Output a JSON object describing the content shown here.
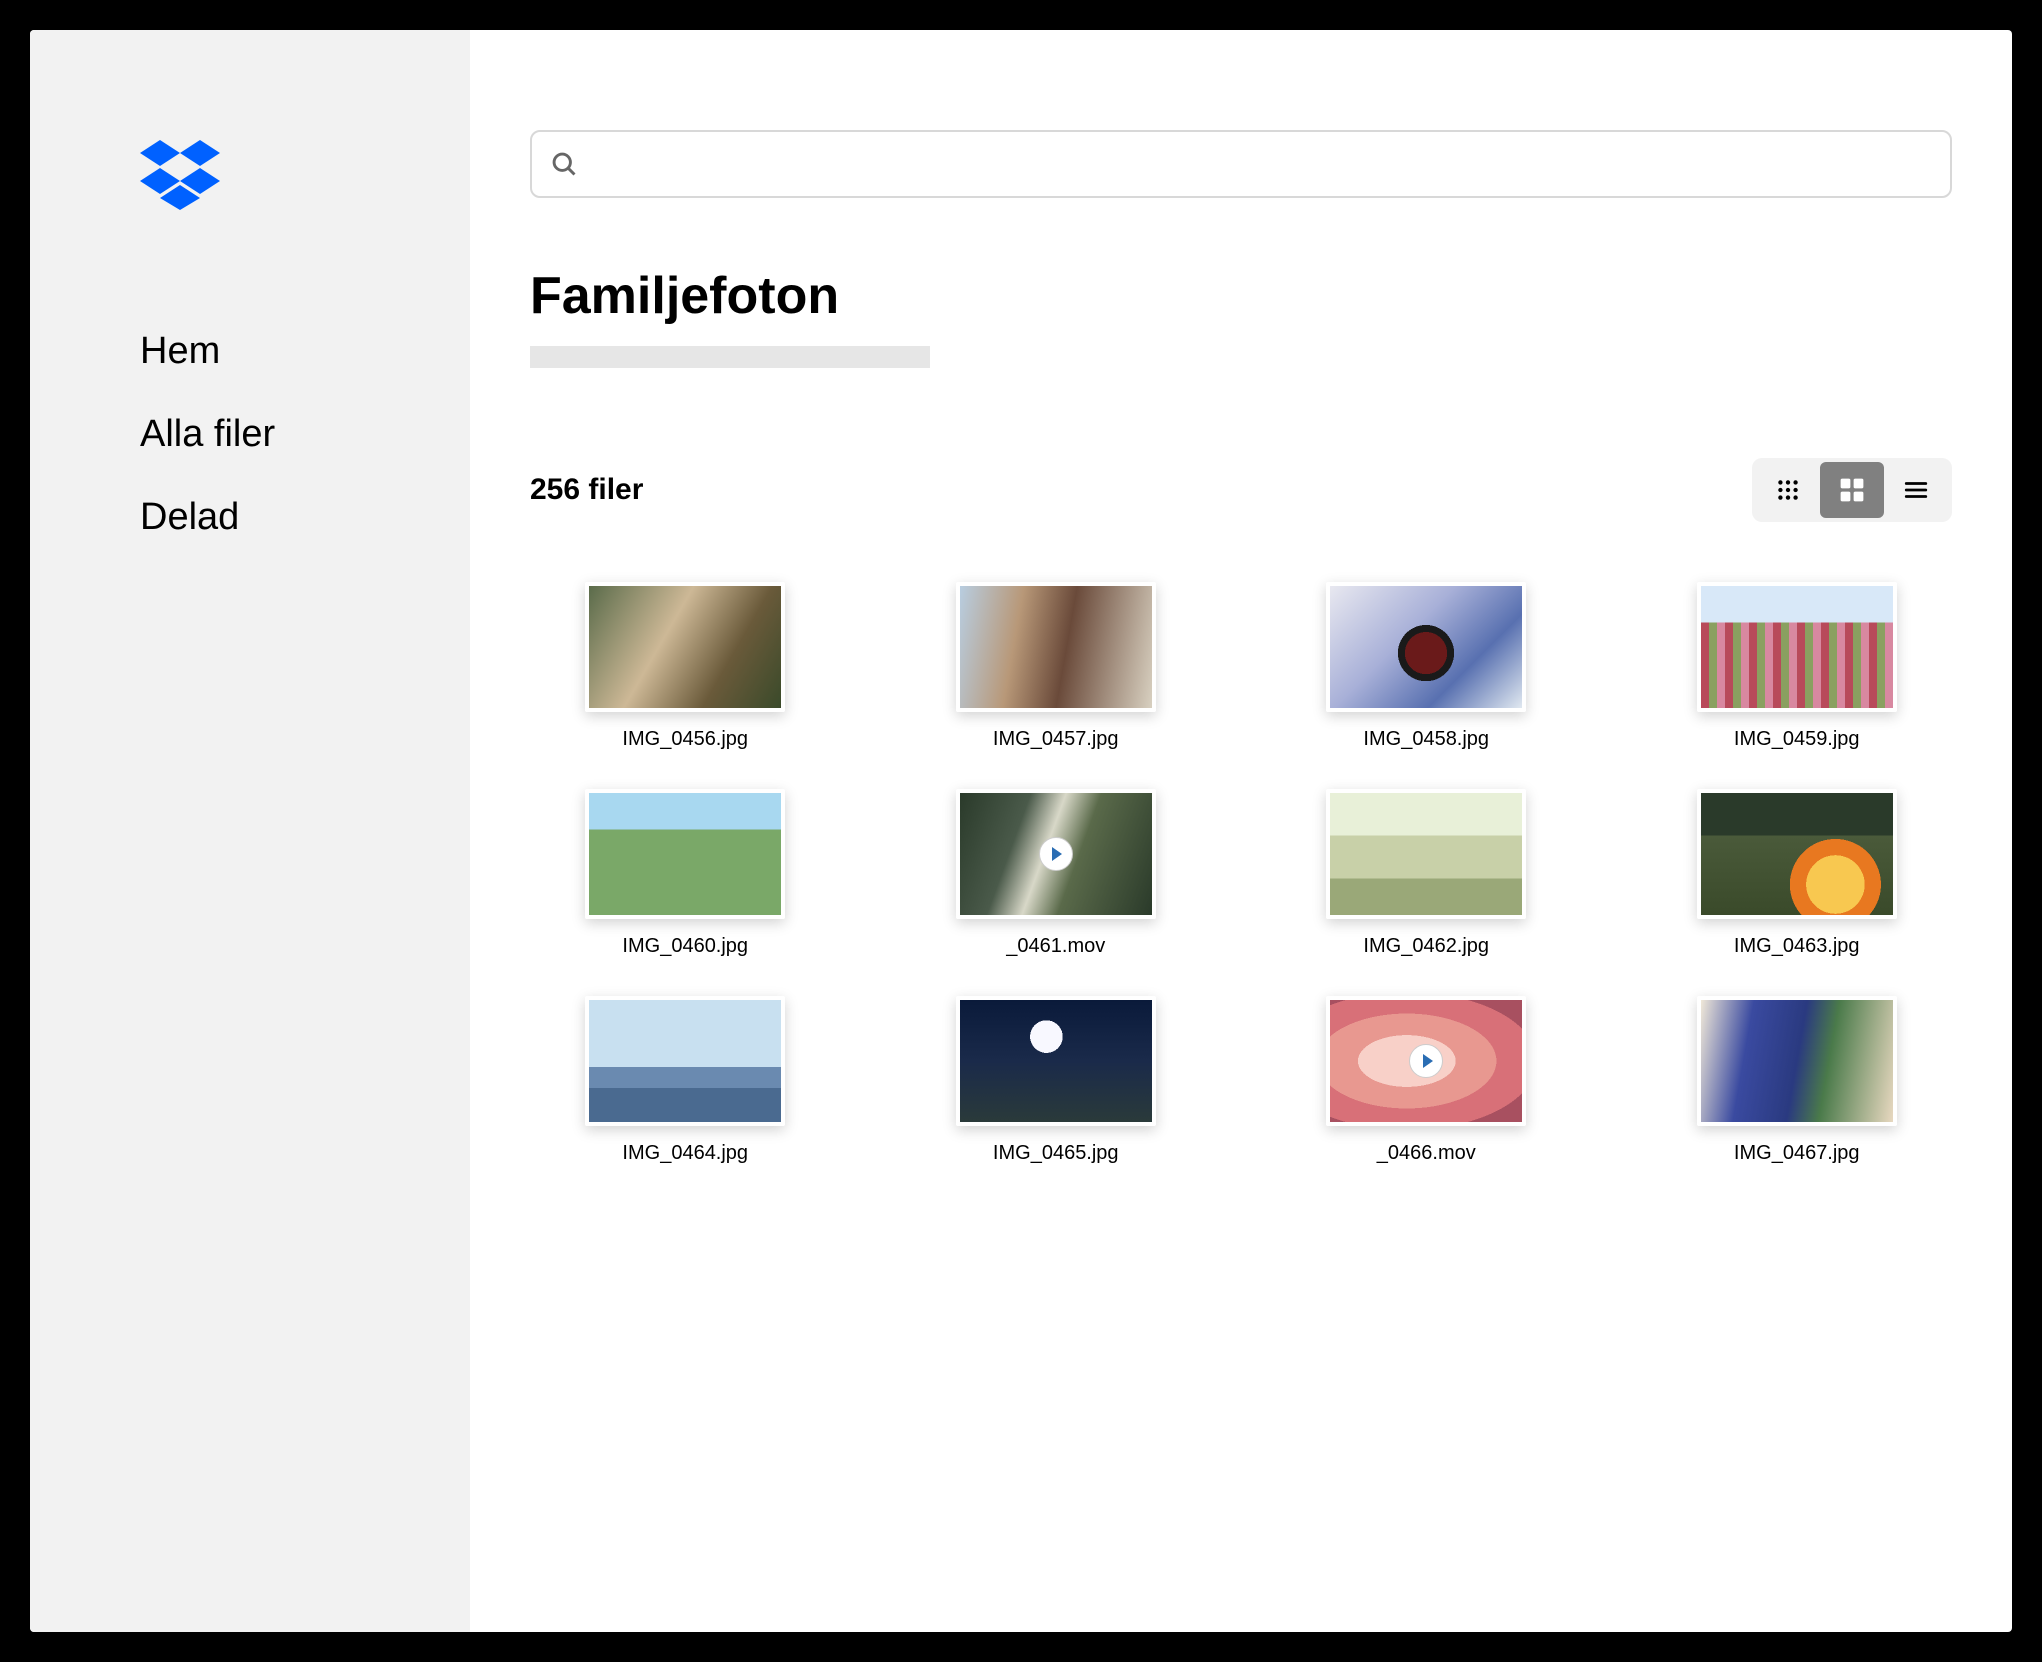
{
  "sidebar": {
    "items": [
      "Hem",
      "Alla filer",
      "Delad"
    ]
  },
  "search": {
    "placeholder": ""
  },
  "page": {
    "title": "Familjefoton",
    "file_count": "256 filer"
  },
  "files": [
    {
      "name": "IMG_0456.jpg",
      "is_video": false,
      "thumb_class": "t0"
    },
    {
      "name": "IMG_0457.jpg",
      "is_video": false,
      "thumb_class": "t1"
    },
    {
      "name": "IMG_0458.jpg",
      "is_video": false,
      "thumb_class": "t2"
    },
    {
      "name": "IMG_0459.jpg",
      "is_video": false,
      "thumb_class": "t3"
    },
    {
      "name": "IMG_0460.jpg",
      "is_video": false,
      "thumb_class": "t4"
    },
    {
      "name": "_0461.mov",
      "is_video": true,
      "thumb_class": "t5"
    },
    {
      "name": "IMG_0462.jpg",
      "is_video": false,
      "thumb_class": "t6"
    },
    {
      "name": "IMG_0463.jpg",
      "is_video": false,
      "thumb_class": "t7"
    },
    {
      "name": "IMG_0464.jpg",
      "is_video": false,
      "thumb_class": "t8"
    },
    {
      "name": "IMG_0465.jpg",
      "is_video": false,
      "thumb_class": "t9"
    },
    {
      "name": "_0466.mov",
      "is_video": true,
      "thumb_class": "t10"
    },
    {
      "name": "IMG_0467.jpg",
      "is_video": false,
      "thumb_class": "t11"
    }
  ],
  "view_modes": {
    "active": "grid-large"
  }
}
